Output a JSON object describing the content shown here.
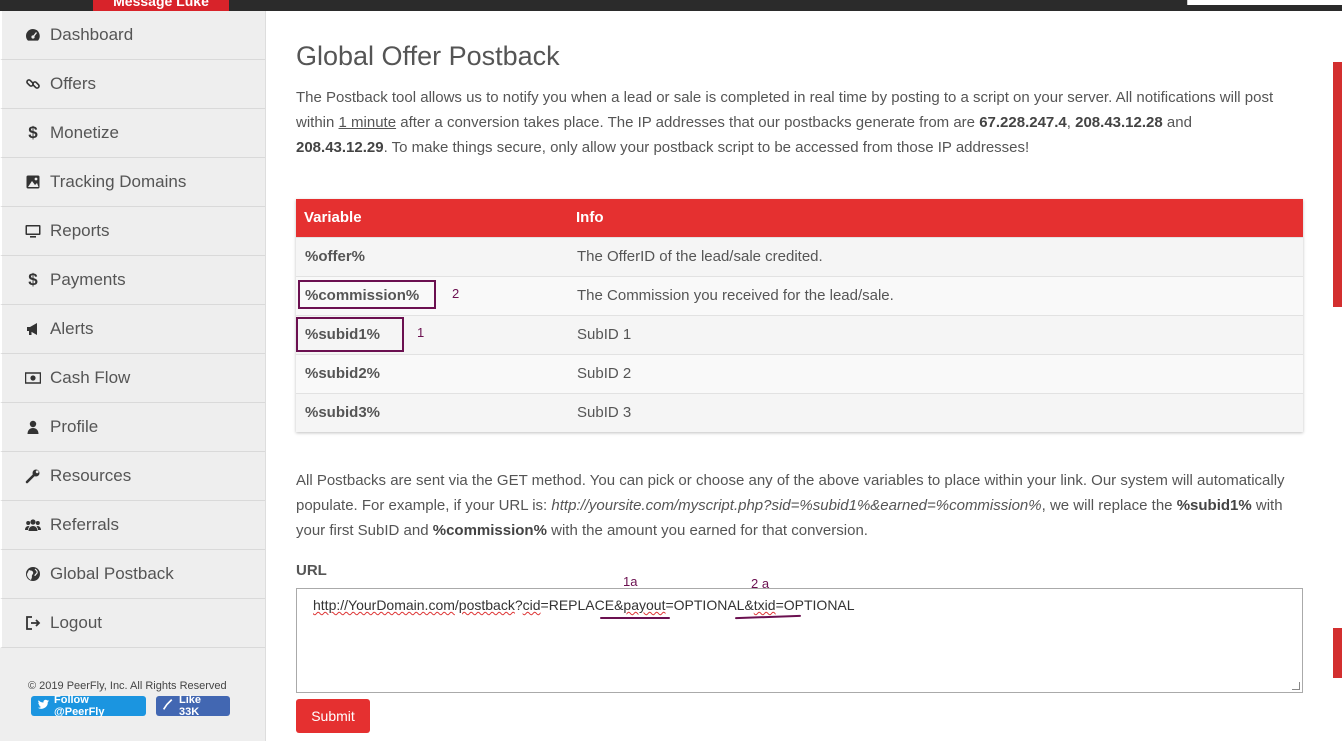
{
  "header": {
    "brand": "Message Luke"
  },
  "sidebar": {
    "items": [
      {
        "label": "Dashboard",
        "icon": "dashboard-icon"
      },
      {
        "label": "Offers",
        "icon": "link-icon"
      },
      {
        "label": "Monetize",
        "icon": "dollar-icon"
      },
      {
        "label": "Tracking Domains",
        "icon": "image-icon"
      },
      {
        "label": "Reports",
        "icon": "monitor-icon"
      },
      {
        "label": "Payments",
        "icon": "dollar-icon"
      },
      {
        "label": "Alerts",
        "icon": "bullhorn-icon"
      },
      {
        "label": "Cash Flow",
        "icon": "money-icon"
      },
      {
        "label": "Profile",
        "icon": "user-icon"
      },
      {
        "label": "Resources",
        "icon": "wrench-icon"
      },
      {
        "label": "Referrals",
        "icon": "users-icon"
      },
      {
        "label": "Global Postback",
        "icon": "globe-icon"
      },
      {
        "label": "Logout",
        "icon": "logout-icon"
      }
    ],
    "copyright": "© 2019 PeerFly, Inc. All Rights Reserved",
    "twitter_label": "Follow @PeerFly",
    "facebook_label": "Like 33K"
  },
  "main": {
    "title": "Global Offer Postback",
    "intro": {
      "p1": "The Postback tool allows us to notify you when a lead or sale is completed in real time by posting to a script on your server. All notifications will post within ",
      "minute": "1 minute",
      "p2": " after a conversion takes place. The IP addresses that our postbacks generate from are ",
      "ip1": "67.228.247.4",
      "sep1": ", ",
      "ip2": "208.43.12.28",
      "and": " and ",
      "ip3": "208.43.12.29",
      "p3": ". To make things secure, only allow your postback script to be accessed from those IP addresses!"
    },
    "table": {
      "headers": [
        "Variable",
        "Info"
      ],
      "rows": [
        {
          "var": "%offer%",
          "info": "The OfferID of the lead/sale credited."
        },
        {
          "var": "%commission%",
          "info": "The Commission you received for the lead/sale."
        },
        {
          "var": "%subid1%",
          "info": "SubID 1"
        },
        {
          "var": "%subid2%",
          "info": "SubID 2"
        },
        {
          "var": "%subid3%",
          "info": "SubID 3"
        }
      ]
    },
    "explain": {
      "p1": "All Postbacks are sent via the GET method. You can pick or choose any of the above variables to place within your link. Our system will automatically populate. For example, if your URL is: ",
      "example": "http://yoursite.com/myscript.php?sid=%subid1%&earned=%commission%",
      "p2": ", we will replace the ",
      "b1": "%subid1%",
      "p3": " with your first SubID and ",
      "b2": "%commission%",
      "p4": " with the amount you earned for that conversion."
    },
    "url_label": "URL",
    "url_parts": {
      "a": "http://",
      "b": "YourDomain.com",
      "c": "/",
      "d": "postback",
      "e": "?",
      "f": "cid",
      "g": "=REPLACE&",
      "h": "payout",
      "i": "=OPTIONAL&",
      "j": "txid",
      "k": "=OPTIONAL"
    },
    "submit_label": "Submit"
  },
  "annotations": {
    "n1": "1",
    "n2": "2",
    "n1a": "1a",
    "n2a": "2 a"
  },
  "colors": {
    "accent": "#e53030",
    "annotation": "#6b1050"
  }
}
